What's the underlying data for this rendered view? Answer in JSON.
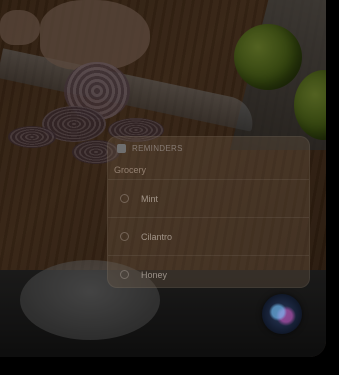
{
  "panel": {
    "app_name": "REMINDERS",
    "list_title": "Grocery",
    "items": [
      {
        "label": "Mint"
      },
      {
        "label": "Cilantro"
      },
      {
        "label": "Honey"
      }
    ]
  },
  "icons": {
    "app": "reminders-icon",
    "siri": "siri-orb-icon",
    "check": "checkbox-circle-icon"
  }
}
